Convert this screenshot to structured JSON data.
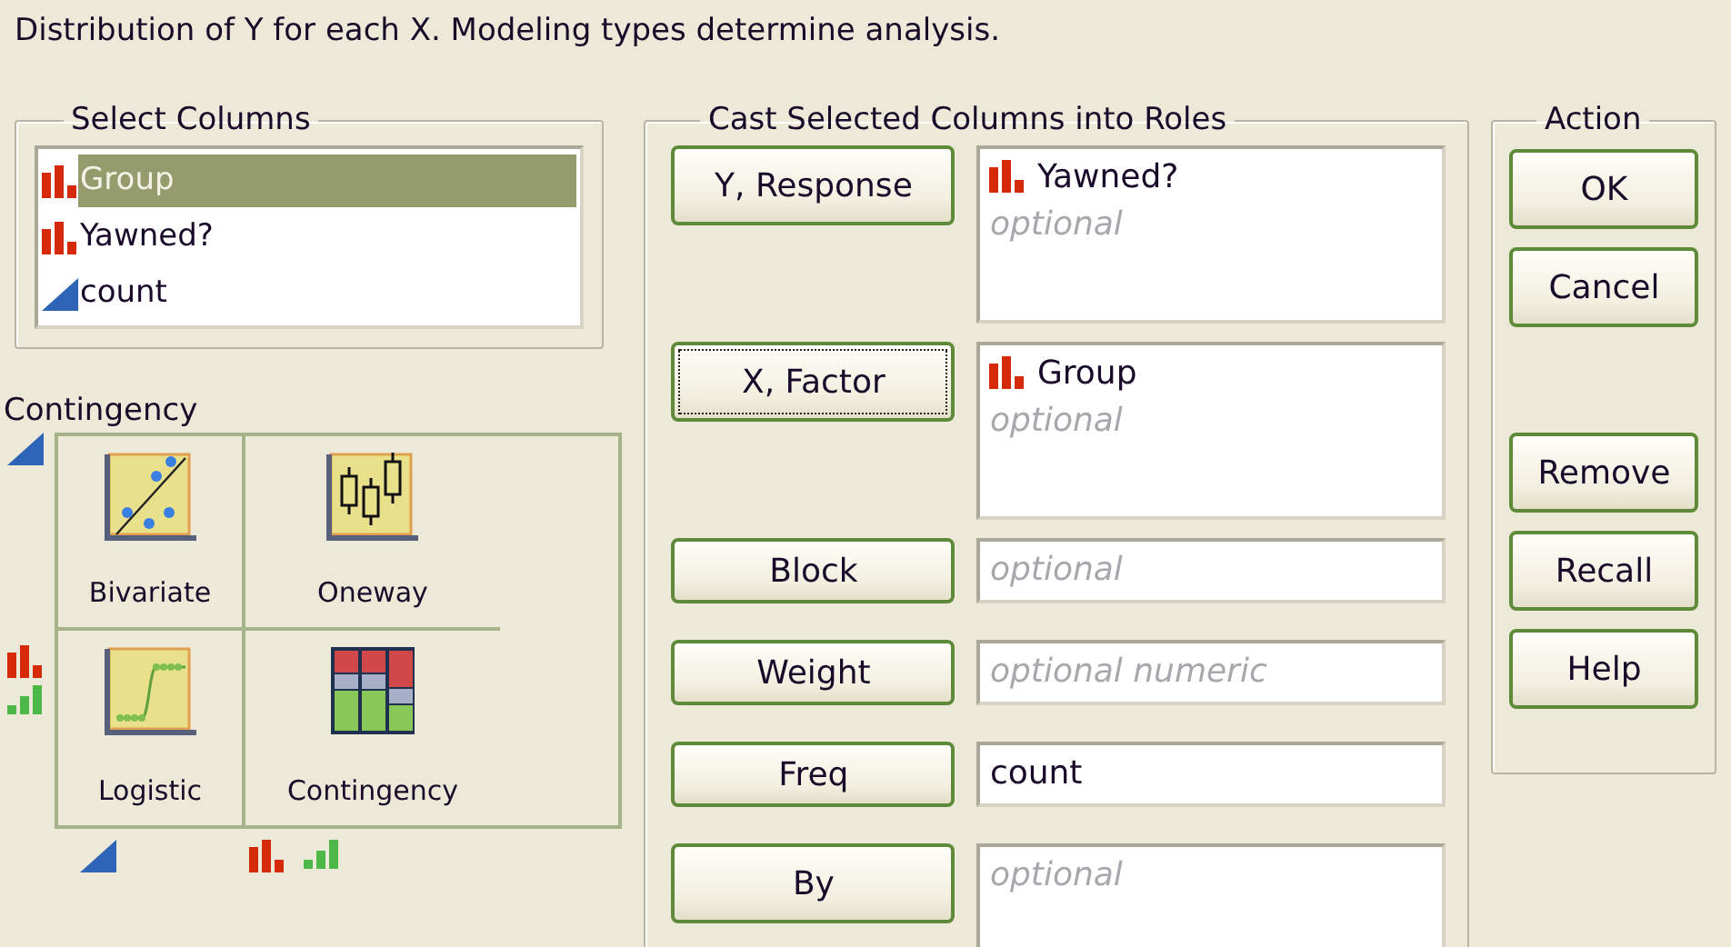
{
  "header": "Distribution of Y for each X. Modeling types determine analysis.",
  "select_columns": {
    "title": "Select Columns",
    "items": [
      {
        "name": "Group",
        "kind": "nominal",
        "selected": true
      },
      {
        "name": "Yawned?",
        "kind": "nominal",
        "selected": false
      },
      {
        "name": "count",
        "kind": "continuous",
        "selected": false
      }
    ]
  },
  "platform": {
    "title": "Contingency",
    "row_markers": [
      [
        {
          "kind": "continuous"
        }
      ],
      [
        {
          "kind": "nominal"
        },
        {
          "kind": "ordinal"
        }
      ]
    ],
    "column_markers": [
      [
        {
          "kind": "continuous"
        }
      ],
      [
        {
          "kind": "nominal"
        },
        {
          "kind": "ordinal"
        }
      ]
    ],
    "cells": [
      {
        "label": "Bivariate",
        "kind": "bivariate"
      },
      {
        "label": "Oneway",
        "kind": "oneway"
      },
      {
        "label": "Logistic",
        "kind": "logistic"
      },
      {
        "label": "Contingency",
        "kind": "contingency"
      }
    ]
  },
  "roles": {
    "title": "Cast Selected Columns into Roles",
    "items": [
      {
        "button": "Y, Response",
        "focused": false,
        "kind": "list",
        "items": [
          {
            "name": "Yawned?",
            "kind": "nominal"
          }
        ],
        "placeholder": "optional"
      },
      {
        "button": "X, Factor",
        "focused": true,
        "kind": "list",
        "items": [
          {
            "name": "Group",
            "kind": "nominal"
          }
        ],
        "placeholder": "optional"
      },
      {
        "button": "Block",
        "focused": false,
        "kind": "line",
        "placeholder": "optional"
      },
      {
        "button": "Weight",
        "focused": false,
        "kind": "line",
        "placeholder": "optional numeric"
      },
      {
        "button": "Freq",
        "focused": false,
        "kind": "line",
        "value": "count"
      },
      {
        "button": "By",
        "focused": false,
        "kind": "list",
        "placeholder": "optional"
      }
    ]
  },
  "action": {
    "title": "Action",
    "button_groups": [
      [
        {
          "label": "OK"
        },
        {
          "label": "Cancel"
        }
      ],
      [
        {
          "label": "Remove"
        },
        {
          "label": "Recall"
        },
        {
          "label": "Help"
        }
      ]
    ]
  }
}
